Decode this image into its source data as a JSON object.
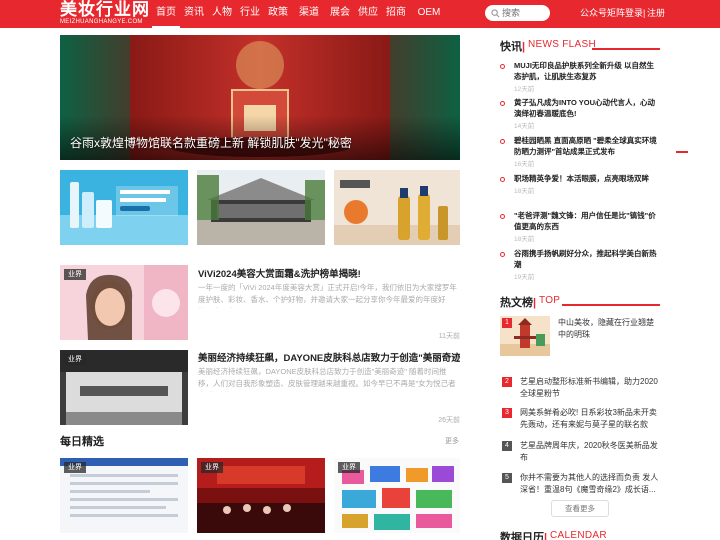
{
  "header": {
    "logo_cn": "美妆行业网",
    "logo_en": "MEIZHUANGHANGYE.COM",
    "nav": [
      "首页",
      "资讯",
      "人物",
      "行业",
      "政策",
      "渠道",
      "展会",
      "供应",
      "招商",
      "OEM"
    ],
    "active_nav": 0,
    "search_placeholder": "搜索",
    "matrix": "公众号矩阵",
    "login": "登录",
    "divider": "|",
    "register": "注册"
  },
  "hero": {
    "caption": "谷雨x敦煌博物馆联名款重磅上新 解锁肌肤\"发光\"秘密",
    "slides": 4,
    "active_slide": 1
  },
  "thumbs": [
    {
      "alt": "唤醒深海能量 抗皱修护紧致",
      "name": "skincare-ad"
    },
    {
      "alt": "building",
      "name": "building-photo"
    },
    {
      "alt": "海护士",
      "name": "oil-product"
    }
  ],
  "articles": [
    {
      "tag": "业界",
      "title": "ViVi2024美容大赏面霜&洗护榜单揭晓!",
      "desc": "一年一度的「ViVi 2024年度美容大赏」正式开启!今年，我们依旧为大家搜罗年度护肤、彩妆、香水、个护好物，并邀请大家一起分享你今年最爱的年度好物！今天为...",
      "time": "11天前"
    },
    {
      "tag": "业界",
      "title": "美丽经济持续狂飙，DAYONE皮肤科总店致力于创造\"美丽奇迹\"",
      "desc": "美丽经济持续狂飙，DAYONE皮肤科总店致力于创造\"美丽奇迹\" 随着时间推移，人们对自我形象塑造、皮肤管理越来越重视。如今早已不再是\"女为悦己者容\"的时代，...",
      "time": "26天前"
    }
  ],
  "daily": {
    "title": "每日精选",
    "more": "更多",
    "items": [
      {
        "tag": "业界",
        "name": "pick-document"
      },
      {
        "tag": "业界",
        "name": "pick-event"
      },
      {
        "tag": "业界",
        "name": "pick-words"
      }
    ]
  },
  "flash": {
    "title_cn": "快讯",
    "sep": "|",
    "title_en": "NEWS FLASH",
    "items": [
      {
        "title": "MUJI无印良品护肤系列全新升级 以自然生态护肌，让肌肤生态复苏",
        "time": "12天前"
      },
      {
        "title": "黄子弘凡成为INTO YOU心动代言人，心动演绎初春温暖底色!",
        "time": "14天前"
      },
      {
        "title": "碧桂园晒黑 直面高原晒 \"碧柔全球真实环境防晒力测评\"首站成果正式发布",
        "time": "16天前"
      },
      {
        "title": "职场精英争爱！本活眼膜，点亮眼场双眸",
        "time": "18天前"
      },
      {
        "title": "\"老爸评测\"魏文锋：用户信任是比\"镐钱\"价值更高的东西",
        "time": "18天前"
      },
      {
        "title": "谷雨携手扬帆刷好分众，推起科学美白新热潮",
        "time": "19天前"
      }
    ]
  },
  "hot": {
    "title_cn": "热文榜",
    "sep": "|",
    "title_en": "TOP",
    "items": [
      {
        "num": "1",
        "title": "中山美妆，隐藏在行业翘楚中的明珠"
      },
      {
        "num": "2",
        "title": "艺星启动整形标准新书编辑，助力2020全球星粉节"
      },
      {
        "num": "3",
        "title": "网美系鲜肴必吹! 日系彩妆3新品未开卖先轰动，还有来妮与莫子星的联名款"
      },
      {
        "num": "4",
        "title": "艺星品牌周年庆，2020秋冬医美新品发布"
      },
      {
        "num": "5",
        "title": "你并不需要为其他人的选择而负责 发人深省！重温8句《魔雪奇缘2》成长语..."
      }
    ],
    "view_more": "查看更多"
  },
  "calendar": {
    "title_cn": "数据日历",
    "sep": "|",
    "title_en": "CALENDAR"
  },
  "colors": {
    "brand": "#e8282f",
    "text": "#333333",
    "muted": "#aaaaaa"
  }
}
